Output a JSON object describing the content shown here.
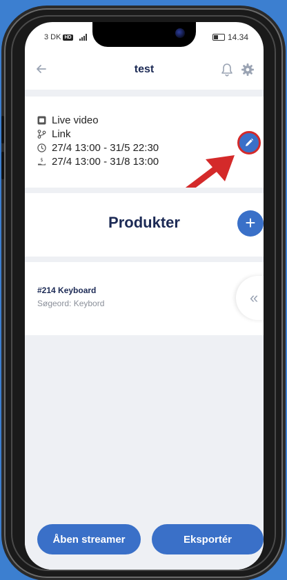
{
  "status_bar": {
    "carrier": "3 DK",
    "network_badge": "HD",
    "time": "14.34"
  },
  "header": {
    "title": "test",
    "back_icon": "arrow-left-icon",
    "bell_icon": "bell-icon",
    "settings_icon": "gear-icon"
  },
  "info": {
    "items": [
      {
        "icon": "video-square-icon",
        "text": "Live video"
      },
      {
        "icon": "link-branch-icon",
        "text": "Link"
      },
      {
        "icon": "clock-icon",
        "text": "27/4 13:00 - 31/5 22:30"
      },
      {
        "icon": "hand-coin-icon",
        "text": "27/4 13:00 - 31/8 13:00"
      }
    ],
    "edit_icon": "pencil-icon"
  },
  "products": {
    "title": "Produkter",
    "add_icon": "plus-icon",
    "items": [
      {
        "name": "#214 Keyboard",
        "keyword": "Søgeord: Keybord"
      }
    ],
    "collapse_icon": "«"
  },
  "footer": {
    "open_streamer": "Åben streamer",
    "export": "Eksportér"
  },
  "colors": {
    "background": "#3c7fd0",
    "accent": "#3a70c8",
    "title": "#1c2a55",
    "annotation": "#d42a2a"
  }
}
